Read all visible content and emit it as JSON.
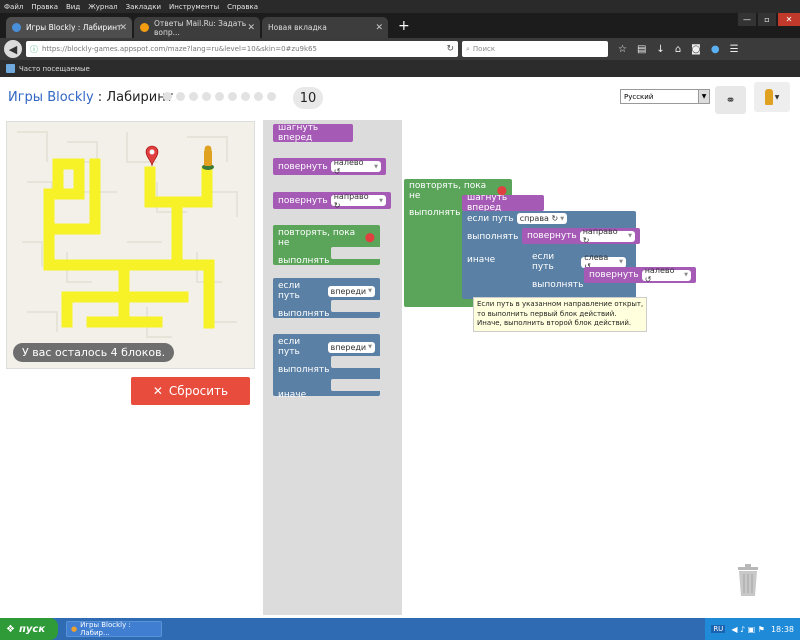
{
  "browser": {
    "menu": [
      "Файл",
      "Правка",
      "Вид",
      "Журнал",
      "Закладки",
      "Инструменты",
      "Справка"
    ],
    "tabs": [
      {
        "title": "Игры Blockly : Лабиринт"
      },
      {
        "title": "Ответы Mail.Ru: Задать вопр..."
      },
      {
        "title": "Новая вкладка"
      }
    ],
    "url": "https://blockly-games.appspot.com/maze?lang=ru&level=10&skin=0#zu9k65",
    "search_placeholder": "Поиск",
    "bookmark": "Часто посещаемые"
  },
  "header": {
    "games_link": "Игры Blockly",
    "separator": " : ",
    "title": "Лабиринт",
    "level_count": 9,
    "current_level": "10",
    "language": "Русский"
  },
  "maze": {
    "remaining": "У вас осталось 4 блоков."
  },
  "reset_label": "Сбросить",
  "toolbox": {
    "move_forward": "шагнуть вперед",
    "turn": "повернуть",
    "left_option": "налево ↺",
    "right_option": "направо ↻",
    "repeat_until": "повторять, пока не",
    "do": "выполнять",
    "if_path": "если путь",
    "ahead_option": "впереди",
    "else": "иначе"
  },
  "program": {
    "repeat_until": "повторять, пока не",
    "do": "выполнять",
    "move_forward": "шагнуть вперед",
    "if_path": "если путь",
    "right_option": "справа ↻",
    "turn": "повернуть",
    "turn_right": "направо ↻",
    "else": "иначе",
    "left_option": "слева ↺",
    "turn_left": "налево ↺"
  },
  "tooltip": [
    "Если путь в указанном направление открыт,",
    "то выполнить первый блок действий.",
    "Иначе, выполнить второй блок действий."
  ],
  "taskbar": {
    "start": "пуск",
    "window": "Игры Blockly : Лабир...",
    "lang": "RU",
    "clock": "18:38"
  },
  "colors": {
    "movement": "#a55ab5",
    "loop": "#5ba55b",
    "logic": "#5b80a5",
    "path": "#f6f227",
    "reset": "#e74c3c"
  }
}
